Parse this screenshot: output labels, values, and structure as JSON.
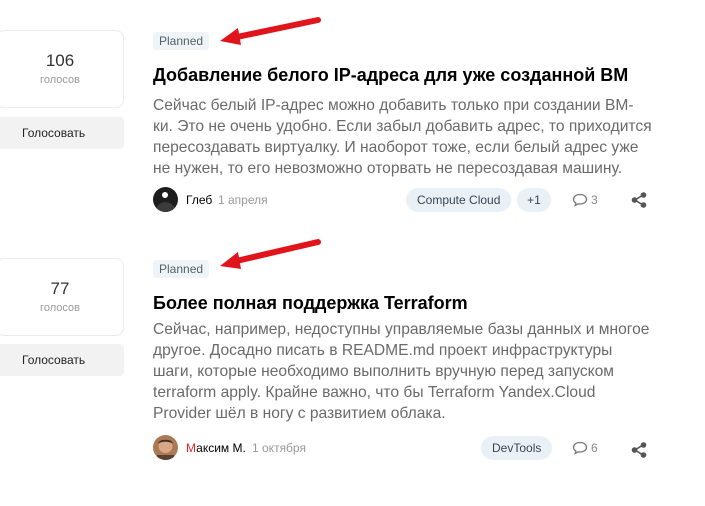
{
  "posts": [
    {
      "votes": "106",
      "votes_label": "голосов",
      "vote_button": "Голосовать",
      "status": "Planned",
      "title": "Добавление белого IP-адреса для уже созданной ВМ",
      "description_lines": [
        "Сейчас белый IP-адрес можно добавить только при создании ВМ-",
        "ки. Это не очень удобно. Если забыл добавить адрес, то приходится",
        "пересоздавать виртуалку. И наоборот тоже, если белый адрес уже",
        "не нужен, то его невозможно оторвать не пересоздавая машину."
      ],
      "author": "Глеб",
      "date": "1 апреля",
      "tag": "Compute Cloud",
      "extra_tags": "+1",
      "comments": "3",
      "avatar_icon": "dark-avatar"
    },
    {
      "votes": "77",
      "votes_label": "голосов",
      "vote_button": "Голосовать",
      "status": "Planned",
      "title": "Более полная поддержка Terraform",
      "description_lines": [
        "Сейчас, например, недоступны управляемые базы данных и многое",
        "другое. Досадно писать в README.md проект инфраструктуры",
        "шаги, которые необходимо выполнить вручную перед запуском",
        "terraform apply. Крайне важно, что бы Terraform Yandex.Cloud",
        "Provider шёл в ногу с развитием облака."
      ],
      "author_first": "М",
      "author_rest": "аксим М.",
      "date": "1 октября",
      "tag": "DevTools",
      "comments": "6",
      "avatar_icon": "photo-avatar"
    }
  ],
  "colors": {
    "arrow": "#e0151b",
    "status_bg": "#eef4f7",
    "tag_bg": "#e9f1f6",
    "author_first_letter": "#e3242b"
  }
}
